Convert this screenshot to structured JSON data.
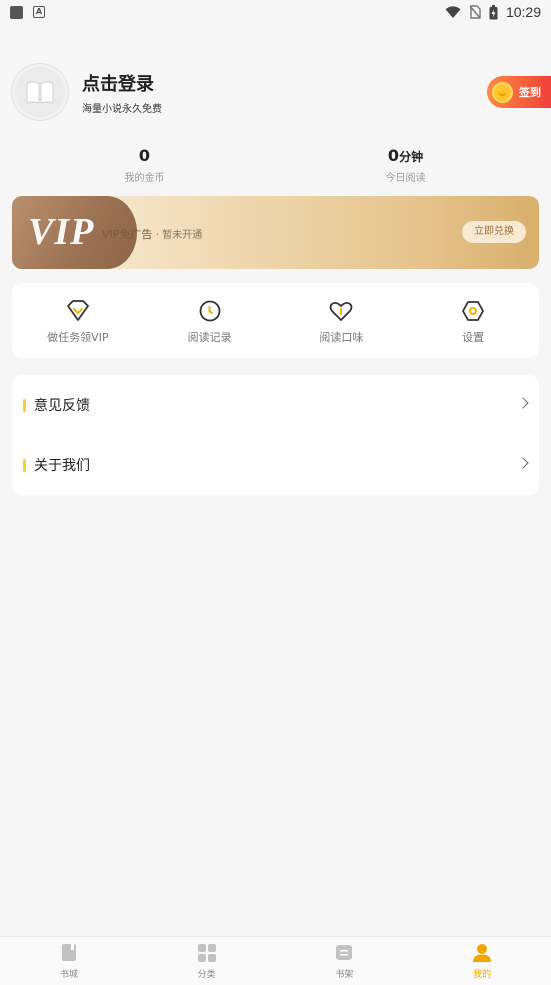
{
  "status_bar": {
    "time": "10:29"
  },
  "profile": {
    "title": "点击登录",
    "subtitle": "海量小说永久免费"
  },
  "signin": {
    "label": "签到"
  },
  "stats": {
    "coins_value": "0",
    "coins_label": "我的金币",
    "reading_value": "0",
    "reading_unit": "分钟",
    "reading_label": "今日阅读"
  },
  "vip": {
    "logo": "VIP",
    "text": "VIP免广告",
    "status": "· 暂未开通",
    "button": "立即兑换"
  },
  "actions": [
    {
      "label": "做任务领VIP",
      "icon": "diamond-icon"
    },
    {
      "label": "阅读记录",
      "icon": "clock-icon"
    },
    {
      "label": "阅读口味",
      "icon": "heart-icon"
    },
    {
      "label": "设置",
      "icon": "gear-icon"
    }
  ],
  "list": [
    {
      "label": "意见反馈"
    },
    {
      "label": "关于我们"
    }
  ],
  "tabs": [
    {
      "label": "书城",
      "icon": "book-icon"
    },
    {
      "label": "分类",
      "icon": "grid-icon"
    },
    {
      "label": "书架",
      "icon": "shelf-icon"
    },
    {
      "label": "我的",
      "icon": "person-icon"
    }
  ],
  "colors": {
    "accent": "#f0a500",
    "signin_start": "#ff8a3c",
    "signin_end": "#f0413b",
    "list_bar": "#ffcd2d"
  }
}
